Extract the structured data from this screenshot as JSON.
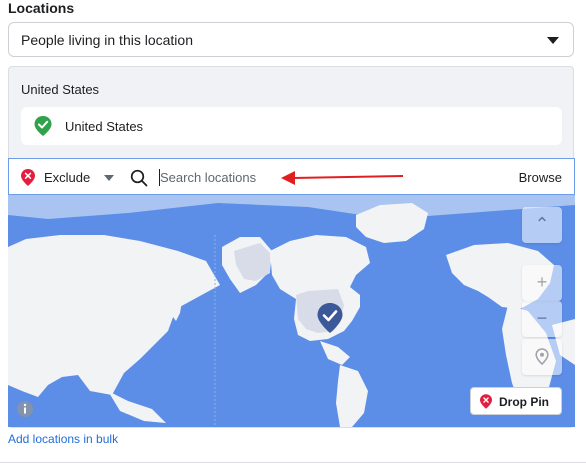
{
  "section": {
    "title": "Locations"
  },
  "targeting_select": {
    "value": "People living in this location"
  },
  "included": {
    "group_title": "United States",
    "items": [
      {
        "label": "United States"
      }
    ]
  },
  "search": {
    "mode_label": "Exclude",
    "placeholder": "Search locations",
    "value": "",
    "browse_label": "Browse"
  },
  "map": {
    "drop_pin_label": "Drop Pin",
    "zoom_in_label": "+",
    "zoom_out_label": "−",
    "scroll_up_label": "⌃"
  },
  "footer": {
    "bulk_link": "Add locations in bulk"
  },
  "colors": {
    "include_green": "#31a24c",
    "exclude_red": "#e41e3f",
    "selected_pin": "#3b5998",
    "arrow_red": "#e02020",
    "ocean": "#5c8ee8",
    "land": "#f2f3f5"
  },
  "icons": [
    "chevron-down-icon",
    "include-pin-icon",
    "exclude-pin-icon",
    "search-icon",
    "red-arrow",
    "info-icon",
    "location-icon",
    "selected-pin-icon"
  ]
}
